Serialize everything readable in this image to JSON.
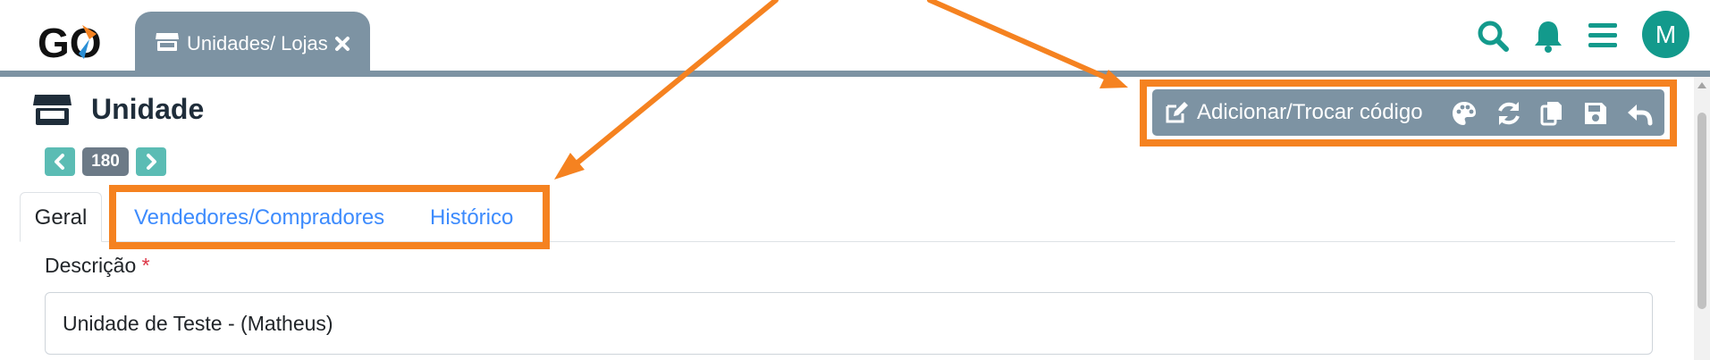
{
  "app": {
    "logo_text": "GO",
    "colors": {
      "brand_teal": "#139a8c",
      "tab_bg": "#7d93a3",
      "highlight": "#f58220",
      "link": "#3d8bfd",
      "required": "#dc3545"
    }
  },
  "header": {
    "open_tab": {
      "label": "Unidades/ Lojas",
      "icon": "store-icon",
      "close_icon": "close-icon"
    },
    "actions": [
      {
        "icon": "search-icon"
      },
      {
        "icon": "bell-icon"
      },
      {
        "icon": "menu-icon"
      }
    ],
    "avatar_initial": "M"
  },
  "page": {
    "title": "Unidade",
    "icon": "store-icon",
    "record_number": "180"
  },
  "toolbar": {
    "add_label": "Adicionar/Trocar código",
    "icons": [
      "palette-icon",
      "refresh-icon",
      "copy-icon",
      "save-icon",
      "undo-icon"
    ]
  },
  "tabs": [
    {
      "label": "Geral",
      "active": true
    },
    {
      "label": "Vendedores/Compradores",
      "active": false
    },
    {
      "label": "Histórico",
      "active": false
    }
  ],
  "form": {
    "descricao": {
      "label": "Descrição",
      "required_mark": "*",
      "value": "Unidade de Teste - (Matheus)"
    }
  }
}
